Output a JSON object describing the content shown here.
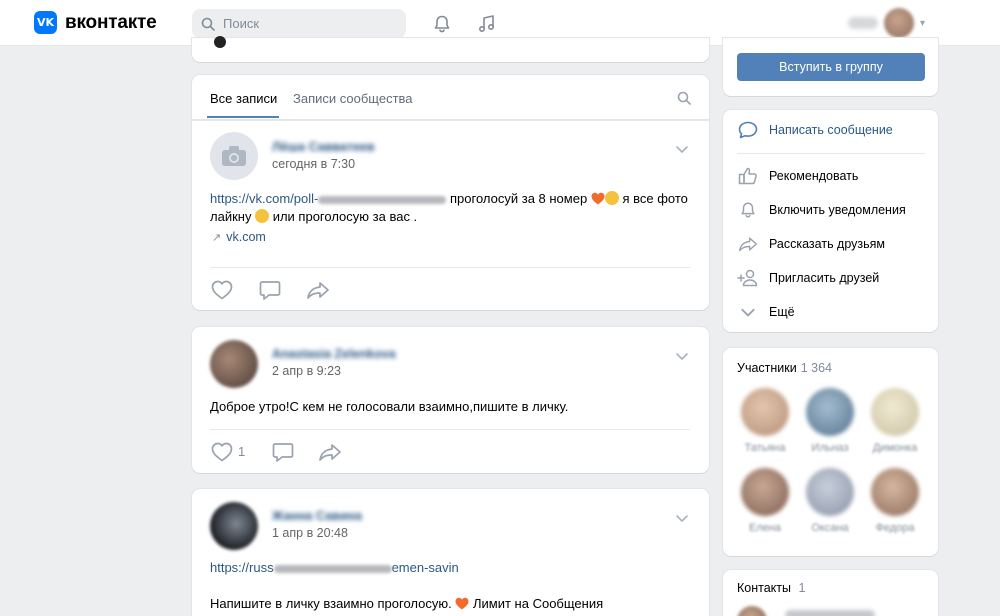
{
  "header": {
    "logo_mark": "VK",
    "logo_text": "вконтакте",
    "search_placeholder": "Поиск",
    "icons": [
      "bell-icon",
      "music-icon"
    ]
  },
  "tabs": {
    "all_posts": "Все записи",
    "community_posts": "Записи сообщества"
  },
  "posts": [
    {
      "author": "Лёша Савватеев",
      "date": "сегодня в 7:30",
      "text_link": "https://vk.com/poll-",
      "text_after": "проголосуй за 8 номер",
      "text_after2": "я все фото",
      "text_line2a": "лайкну",
      "text_line2b": "или проголосую за вас .",
      "link_domain": "vk.com",
      "likes": ""
    },
    {
      "author": "Anastasia Zelenkova",
      "date": "2 апр в 9:23",
      "text": "Доброе утро!С кем не голосовали взаимно,пишите в личку.",
      "likes": "1"
    },
    {
      "author": "Жанна Савина",
      "date": "1 апр в 20:48",
      "text_link_start": "https://russ",
      "text_link_end": "emen-savin",
      "text_line2a": "Напишите в личку взаимно проголосую.",
      "text_line2b": "Лимит на Сообщения"
    }
  ],
  "sidebar": {
    "join_button": "Вступить в группу",
    "menu": [
      {
        "label": "Написать сообщение",
        "icon": "message-icon"
      },
      {
        "label": "Рекомендовать",
        "icon": "thumbs-up-icon"
      },
      {
        "label": "Включить уведомления",
        "icon": "bell-icon"
      },
      {
        "label": "Рассказать друзьям",
        "icon": "share-icon"
      },
      {
        "label": "Пригласить друзей",
        "icon": "add-user-icon"
      },
      {
        "label": "Ещё",
        "icon": "chevron-down-icon"
      }
    ],
    "members_title": "Участники",
    "members_count": "1 364",
    "members": [
      {
        "name": "Татьяна",
        "color": "#d8b9a0"
      },
      {
        "name": "Ильназ",
        "color": "#7f9bb3"
      },
      {
        "name": "Димонка",
        "color": "#e3dcc2"
      },
      {
        "name": "Елена",
        "color": "#b59480"
      },
      {
        "name": "Оксана",
        "color": "#a9b4c4"
      },
      {
        "name": "Федора",
        "color": "#c2a28d"
      }
    ],
    "contacts_title": "Контакты",
    "contacts_count": "1"
  },
  "colors": {
    "accent": "#5181b8",
    "link": "#2a5885",
    "heart": "#e64646"
  }
}
